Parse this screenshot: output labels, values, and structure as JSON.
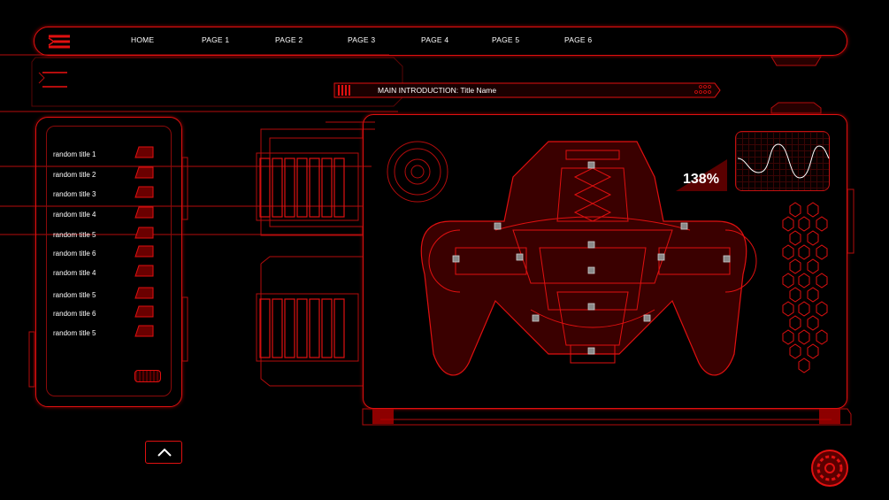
{
  "nav": {
    "items": [
      {
        "label": "HOME"
      },
      {
        "label": "PAGE 1"
      },
      {
        "label": "PAGE 2"
      },
      {
        "label": "PAGE 3"
      },
      {
        "label": "PAGE 4"
      },
      {
        "label": "PAGE 5"
      },
      {
        "label": "PAGE 6"
      }
    ]
  },
  "intro": {
    "label": "MAIN INTRODUCTION: Title Name"
  },
  "list": {
    "items": [
      {
        "label": "random title 1"
      },
      {
        "label": "random title 2"
      },
      {
        "label": "random title 3"
      },
      {
        "label": "random title 4"
      },
      {
        "label": "random title 5"
      },
      {
        "label": "random title 6"
      },
      {
        "label": "random title 4"
      },
      {
        "label": "random title 5"
      },
      {
        "label": "random title 6"
      },
      {
        "label": "random title 5"
      }
    ]
  },
  "main": {
    "percent": "138%"
  },
  "colors": {
    "accent": "#e01010",
    "background": "#000000",
    "text": "#ffffff"
  },
  "icons": {
    "logo": "menu-logo-icon",
    "up": "chevron-up-icon",
    "settings": "gear-icon"
  }
}
